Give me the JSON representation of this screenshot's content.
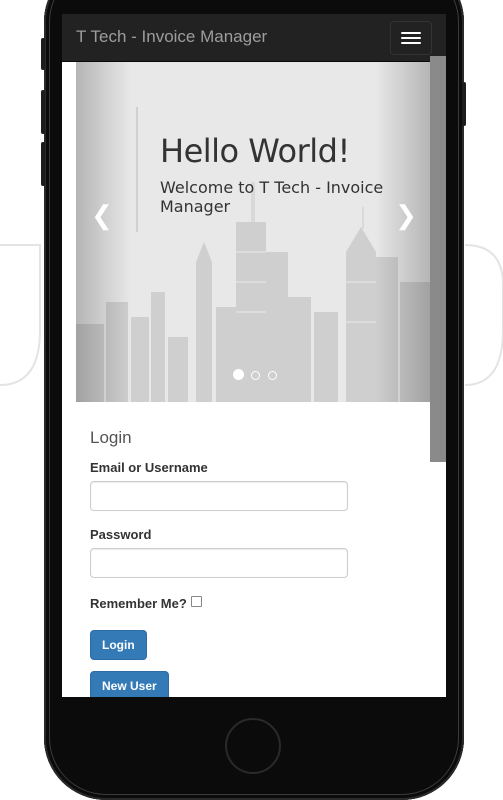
{
  "navbar": {
    "brand": "T Tech - Invoice Manager",
    "menu_icon": "hamburger-icon"
  },
  "carousel": {
    "heading": "Hello World!",
    "subtext": "Welcome to T Tech - Invoice Manager",
    "prev_icon": "chevron-left-icon",
    "next_icon": "chevron-right-icon",
    "prev_glyph": "❮",
    "next_glyph": "❯",
    "slide_count": 3,
    "active_slide": 1
  },
  "login": {
    "title": "Login",
    "username_label": "Email or Username",
    "username_value": "",
    "password_label": "Password",
    "password_value": "",
    "remember_label": "Remember Me?",
    "remember_checked": false,
    "login_button": "Login",
    "new_user_button": "New User"
  },
  "colors": {
    "navbar_bg": "#222222",
    "primary": "#337ab7",
    "phone_body": "#0b0b0b"
  }
}
